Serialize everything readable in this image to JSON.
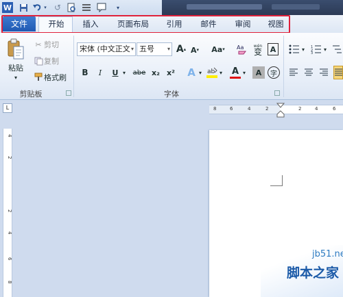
{
  "quick_access": {
    "icons": [
      "word-app-icon",
      "save-icon",
      "undo-icon",
      "undo-dropdown-icon",
      "redo-icon",
      "print-preview-icon",
      "align-icon",
      "comment-icon",
      "customize-qat-icon"
    ]
  },
  "tabs": [
    {
      "label": "文件",
      "name": "tab-file"
    },
    {
      "label": "开始",
      "name": "tab-home"
    },
    {
      "label": "插入",
      "name": "tab-insert"
    },
    {
      "label": "页面布局",
      "name": "tab-page-layout"
    },
    {
      "label": "引用",
      "name": "tab-references"
    },
    {
      "label": "邮件",
      "name": "tab-mailings"
    },
    {
      "label": "审阅",
      "name": "tab-review"
    },
    {
      "label": "视图",
      "name": "tab-view"
    }
  ],
  "clipboard": {
    "paste_label": "粘贴",
    "cut_label": "剪切",
    "copy_label": "复制",
    "format_painter_label": "格式刷",
    "group_label": "剪贴板"
  },
  "font": {
    "font_name": "宋体 (中文正文",
    "font_size": "五号",
    "group_label": "字体",
    "grow_label": "A",
    "shrink_label": "A",
    "case_label": "Aa",
    "bold": "B",
    "italic": "I",
    "underline": "U",
    "strike": "abe",
    "subscript": "x₂",
    "superscript": "x²",
    "char_border": "A",
    "phonetic": "wén",
    "text_effect": "A",
    "font_color": "A",
    "char_shading": "A",
    "enclose": "字"
  },
  "hruler_ticks": [
    "8",
    "6",
    "4",
    "2",
    "2",
    "4",
    "6"
  ],
  "vruler_ticks": [
    "4",
    "2",
    "2",
    "4",
    "6",
    "8"
  ],
  "ruler_corner": "L",
  "watermark": {
    "line1": "jb51.net",
    "line2": "脚本之家"
  },
  "colors": {
    "highlight_box": "#e0203a",
    "file_tab": "#2a66c0"
  }
}
